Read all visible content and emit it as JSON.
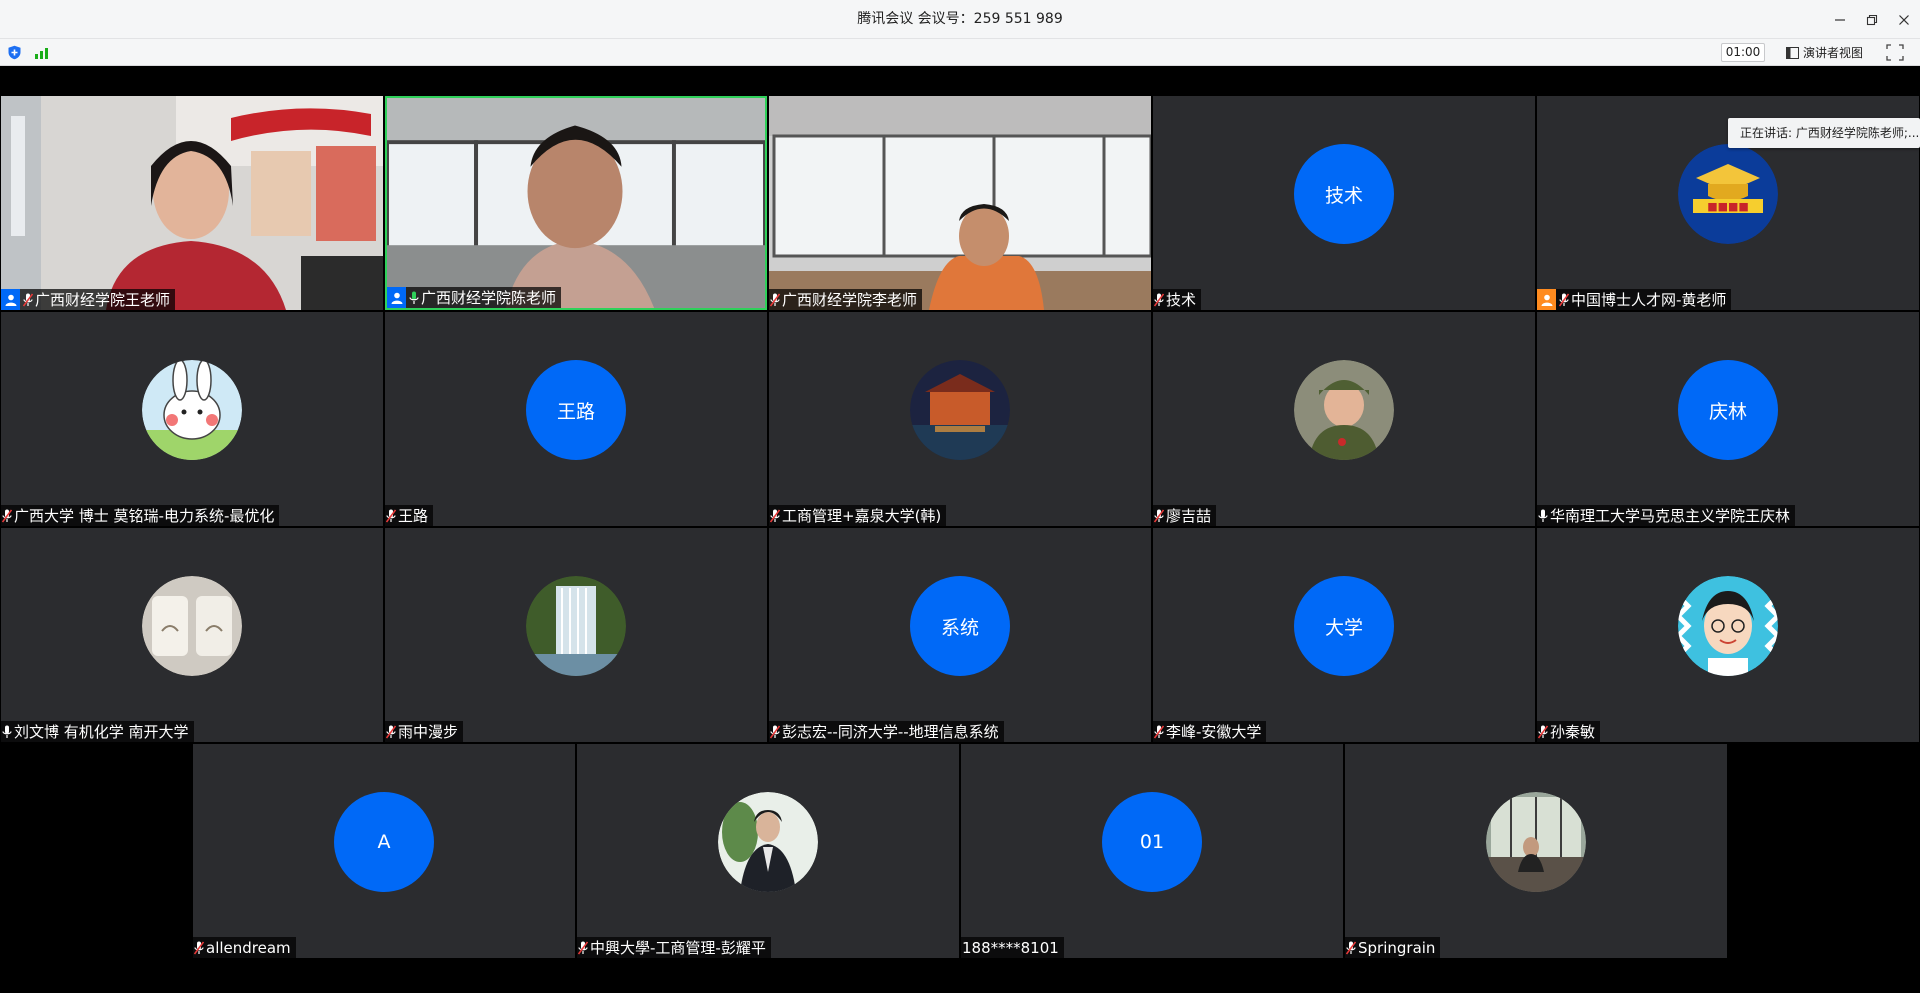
{
  "window": {
    "title": "腾讯会议 会议号：259 551 989"
  },
  "toolbar": {
    "timer": "01:00",
    "view_label": "演讲者视图"
  },
  "speaking_indicator": "正在讲话: 广西财经学院陈老师;...",
  "colors": {
    "avatar_blue": "#0069f7",
    "tile_bg": "#2b2c2f",
    "active_border": "#2fd15a",
    "host_orange": "#ff8b1f"
  },
  "participants": [
    {
      "name": "广西财经学院王老师",
      "avatar": "video",
      "host": "blue"
    },
    {
      "name": "广西财经学院陈老师",
      "avatar": "video",
      "host": "blue",
      "mic": "on",
      "active": true
    },
    {
      "name": "广西财经学院李老师",
      "avatar": "video"
    },
    {
      "name": "技术",
      "avatar_text": "技术"
    },
    {
      "name": "中国博士人才网-黄老师",
      "avatar": "image",
      "host": "orange"
    },
    {
      "name": "广西大学 博士 莫铭瑞-电力系统-最优化",
      "avatar": "image"
    },
    {
      "name": "王路",
      "avatar_text": "王路"
    },
    {
      "name": "工商管理+嘉泉大学(韩)",
      "avatar": "image"
    },
    {
      "name": "廖吉喆",
      "avatar": "image"
    },
    {
      "name": "华南理工大学马克思主义学院王庆林",
      "avatar_text": "庆林",
      "mic": "plain"
    },
    {
      "name": "刘文博 有机化学 南开大学",
      "avatar": "image",
      "mic": "plain"
    },
    {
      "name": "雨中漫步",
      "avatar": "image"
    },
    {
      "name": "彭志宏--同济大学--地理信息系统",
      "avatar_text": "系统"
    },
    {
      "name": "李峰-安徽大学",
      "avatar_text": "大学"
    },
    {
      "name": "孙秦敏",
      "avatar": "image"
    },
    {
      "name": "allendream",
      "avatar_text": "A"
    },
    {
      "name": "中興大學-工商管理-彭耀平",
      "avatar": "image"
    },
    {
      "name": "188****8101",
      "avatar_text": "01",
      "mic": "none"
    },
    {
      "name": "Springrain",
      "avatar": "image"
    }
  ]
}
